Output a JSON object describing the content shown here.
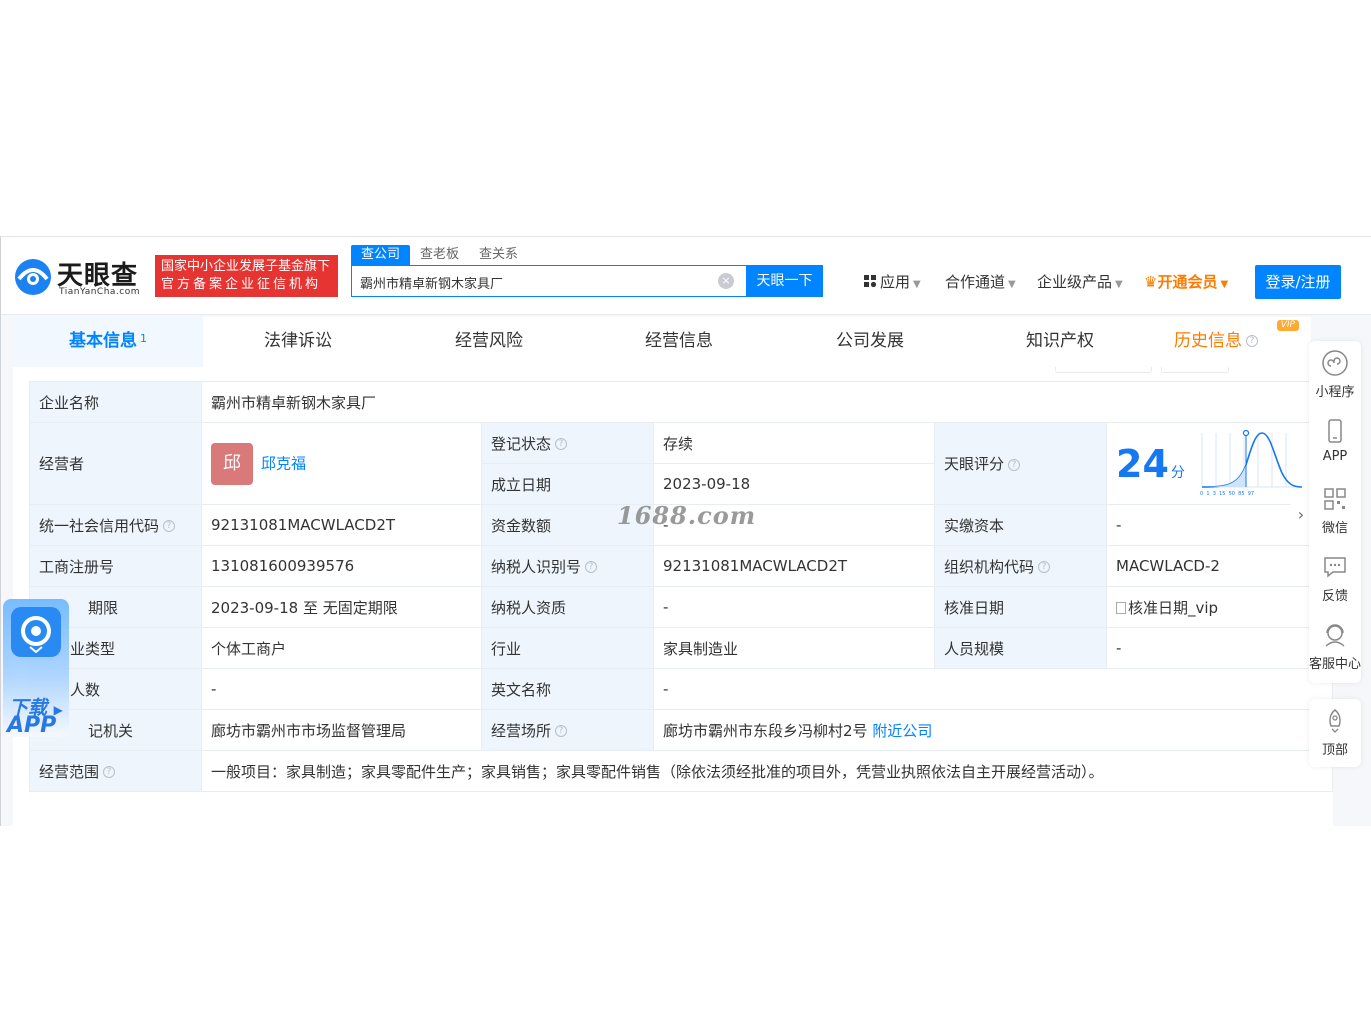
{
  "header": {
    "logo_text": "天眼查",
    "logo_sub": "TianYanCha.com",
    "badge_line1": "国家中小企业发展子基金旗下",
    "badge_line2": "官方备案企业征信机构",
    "search_tabs": [
      "查公司",
      "查老板",
      "查关系"
    ],
    "search_value": "霸州市精卓新钢木家具厂",
    "clear_icon": "×",
    "search_button": "天眼一下",
    "nav": {
      "apps": "应用",
      "partner": "合作通道",
      "enterprise": "企业级产品",
      "vip": "开通会员"
    },
    "login": "登录/注册"
  },
  "tabs": [
    {
      "label": "基本信息",
      "sup": "1"
    },
    {
      "label": "法律诉讼"
    },
    {
      "label": "经营风险"
    },
    {
      "label": "经营信息"
    },
    {
      "label": "公司发展"
    },
    {
      "label": "知识产权"
    },
    {
      "label": "历史信息",
      "vip": "VIP"
    }
  ],
  "help_glyph": "?",
  "info": {
    "company_name_label": "企业名称",
    "company_name": "霸州市精卓新钢木家具厂",
    "operator_label": "经营者",
    "operator_avatar": "邱",
    "operator_name": "邱克福",
    "reg_status_label": "登记状态",
    "reg_status": "存续",
    "founded_label": "成立日期",
    "founded": "2023-09-18",
    "score_label": "天眼评分",
    "score": "24",
    "score_unit": "分",
    "credit_code_label": "统一社会信用代码",
    "credit_code": "92131081MACWLACD2T",
    "capital_label": "资金数额",
    "capital": "-",
    "paid_capital_label": "实缴资本",
    "paid_capital": "-",
    "reg_no_label": "工商注册号",
    "reg_no": "131081600939576",
    "tax_id_label": "纳税人识别号",
    "tax_id": "92131081MACWLACD2T",
    "org_code_label": "组织机构代码",
    "org_code": "MACWLACD-2",
    "term_label": "期限",
    "term": "2023-09-18 至 无固定期限",
    "taxpayer_label": "纳税人资质",
    "taxpayer": "-",
    "approval_label": "核准日期",
    "approval": "核准日期_vip",
    "type_label": "业类型",
    "type": "个体工商户",
    "industry_label": "行业",
    "industry": "家具制造业",
    "staff_label": "人员规模",
    "staff": "-",
    "insured_label": "人数",
    "insured": "-",
    "en_name_label": "英文名称",
    "en_name": "-",
    "authority_label": "记机关",
    "authority": "廊坊市霸州市市场监督管理局",
    "address_label": "经营场所",
    "address": "廊坊市霸州市东段乡冯柳村2号",
    "nearby": "附近公司",
    "scope_label": "经营范围",
    "scope": "一般项目：家具制造；家具零配件生产；家具销售；家具零配件销售（除依法须经批准的项目外，凭营业执照依法自主开展经营活动）。"
  },
  "score_chart_ticks": "0  1  3  15  50  85  97",
  "sidebar": [
    "小程序",
    "APP",
    "微信",
    "反馈",
    "客服中心",
    "顶部"
  ],
  "download": {
    "line1": "下载",
    "line2": "APP"
  },
  "watermark": "1688.com",
  "colors": {
    "accent": "#0084ff",
    "brand_red": "#e63432",
    "vip_orange": "#ff7a00",
    "status_green": "#1aab5c"
  }
}
